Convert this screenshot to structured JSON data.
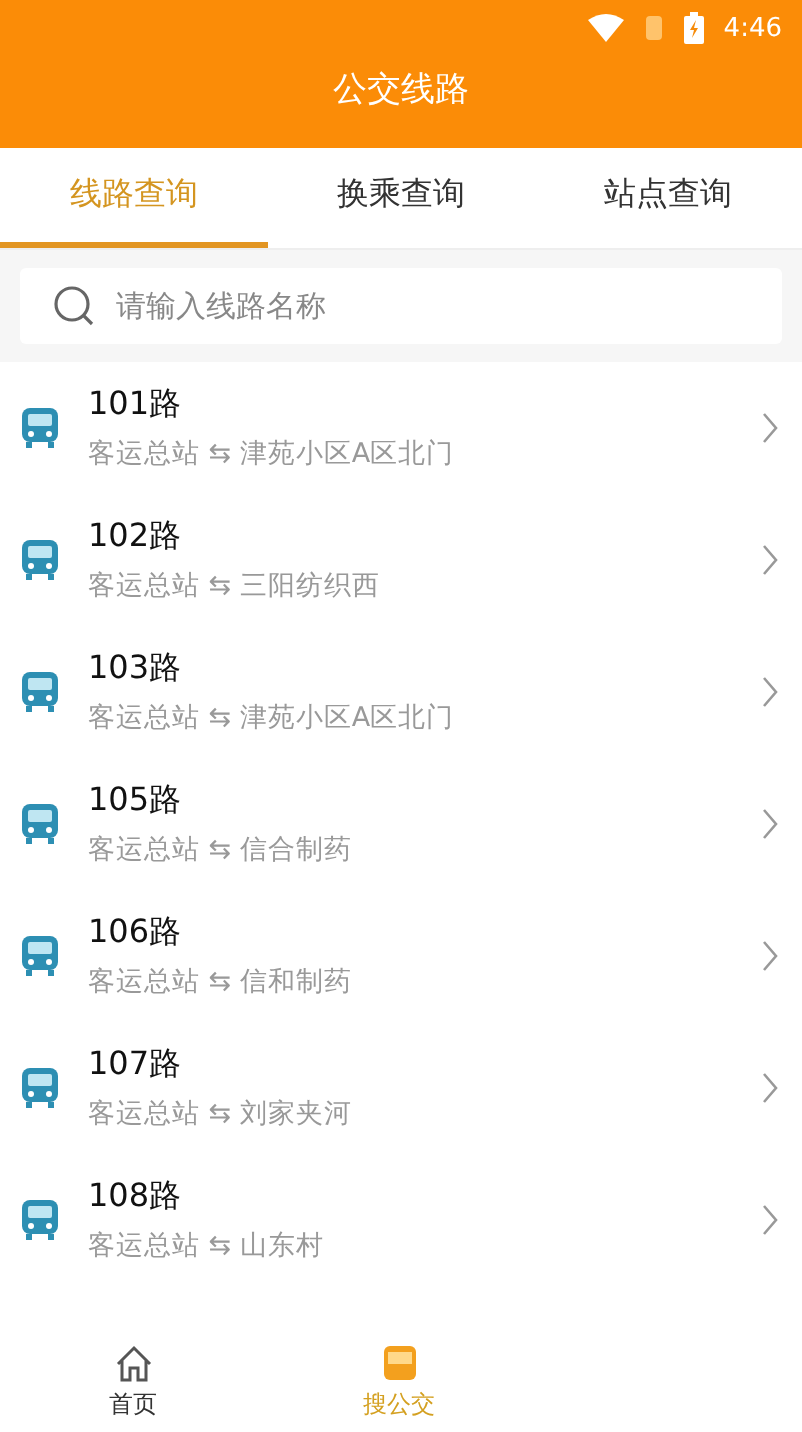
{
  "status_bar": {
    "time": "4:46"
  },
  "header": {
    "title": "公交线路"
  },
  "tabs": [
    {
      "label": "线路查询",
      "selected": true
    },
    {
      "label": "换乘查询",
      "selected": false
    },
    {
      "label": "站点查询",
      "selected": false
    }
  ],
  "search": {
    "placeholder": "请输入线路名称"
  },
  "routes": [
    {
      "name": "101路",
      "stops": "客运总站 ⇆ 津苑小区A区北门"
    },
    {
      "name": "102路",
      "stops": "客运总站 ⇆ 三阳纺织西"
    },
    {
      "name": "103路",
      "stops": "客运总站 ⇆ 津苑小区A区北门"
    },
    {
      "name": "105路",
      "stops": "客运总站 ⇆ 信合制药"
    },
    {
      "name": "106路",
      "stops": "客运总站 ⇆ 信和制药"
    },
    {
      "name": "107路",
      "stops": "客运总站 ⇆ 刘家夹河"
    },
    {
      "name": "108路",
      "stops": "客运总站 ⇆ 山东村"
    }
  ],
  "bottom_nav": [
    {
      "label": "首页",
      "kind": "home",
      "selected": false
    },
    {
      "label": "搜公交",
      "kind": "bus",
      "selected": true
    }
  ]
}
